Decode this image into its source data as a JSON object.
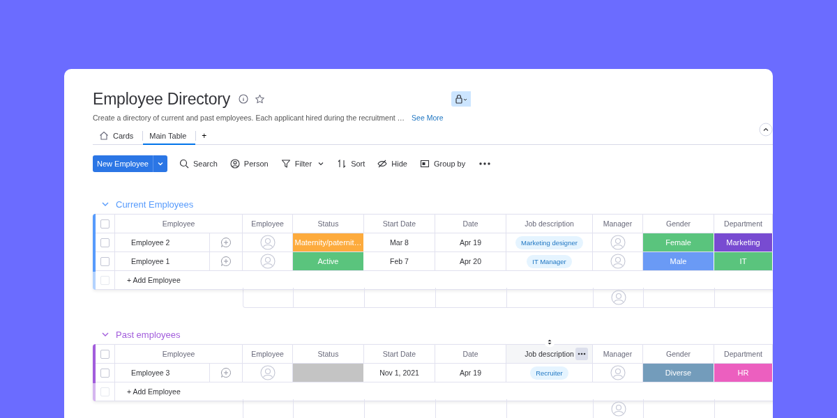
{
  "board": {
    "title": "Employee Directory",
    "description": "Create a directory of current and past employees. Each applicant hired during the recruitment …",
    "see_more": "See More"
  },
  "views": [
    {
      "label": "Cards",
      "kind": "home",
      "selected": false
    },
    {
      "label": "Main Table",
      "kind": "table",
      "selected": true
    }
  ],
  "add_view": "+",
  "toolbar": {
    "primary": "New Employee",
    "items": [
      {
        "label": "Search",
        "kind": "search"
      },
      {
        "label": "Person",
        "kind": "person"
      },
      {
        "label": "Filter",
        "kind": "filter"
      },
      {
        "label": "Sort",
        "kind": "sort"
      },
      {
        "label": "Hide",
        "kind": "hide"
      },
      {
        "label": "Group by",
        "kind": "group"
      }
    ]
  },
  "groups": [
    {
      "title": "Current Employees",
      "color": "#579bfc",
      "add_label": "+ Add Employee",
      "checked": false,
      "add_checkbox_disabled": true,
      "columns": [
        {
          "label": "Employee",
          "highlighted": false
        },
        {
          "label": "Employee",
          "highlighted": false
        },
        {
          "label": "Status",
          "highlighted": false
        },
        {
          "label": "Start Date",
          "highlighted": false
        },
        {
          "label": "Date",
          "highlighted": false
        },
        {
          "label": "Job description",
          "highlighted": false
        },
        {
          "label": "Manager",
          "highlighted": false
        },
        {
          "label": "Gender",
          "highlighted": false
        },
        {
          "label": "Department",
          "highlighted": false
        }
      ],
      "rows": [
        {
          "checked": false,
          "name": "Employee 2",
          "status": {
            "label": "Maternity/paternit…",
            "color": "#fdab3d"
          },
          "start_date": "Mar 8",
          "date": "Apr 19",
          "job": "Marketing designer",
          "gender": {
            "label": "Female",
            "color": "#5ac47d"
          },
          "department": {
            "label": "Marketing",
            "color": "#784bd1"
          }
        },
        {
          "checked": false,
          "name": "Employee 1",
          "status": {
            "label": "Active",
            "color": "#5ac47d"
          },
          "start_date": "Feb 7",
          "date": "Apr 20",
          "job": "IT Manager",
          "gender": {
            "label": "Male",
            "color": "#6a9af5"
          },
          "department": {
            "label": "IT",
            "color": "#5ac47d"
          }
        }
      ]
    },
    {
      "title": "Past employees",
      "color": "#a25ddc",
      "add_label": "+ Add Employee",
      "checked": false,
      "add_checkbox_disabled": true,
      "columns": [
        {
          "label": "Employee",
          "highlighted": false
        },
        {
          "label": "Employee",
          "highlighted": false
        },
        {
          "label": "Status",
          "highlighted": false
        },
        {
          "label": "Start Date",
          "highlighted": false
        },
        {
          "label": "Date",
          "highlighted": false
        },
        {
          "label": "Job description",
          "highlighted": true
        },
        {
          "label": "Manager",
          "highlighted": false
        },
        {
          "label": "Gender",
          "highlighted": false
        },
        {
          "label": "Department",
          "highlighted": false
        }
      ],
      "rows": [
        {
          "checked": false,
          "name": "Employee 3",
          "status": {
            "color": "#c4c4c4"
          },
          "start_date": "Nov 1, 2021",
          "date": "Apr 19",
          "job": "Recruiter",
          "gender": {
            "label": "Diverse",
            "color": "#739cbb"
          },
          "department": {
            "label": "HR",
            "color": "#ec5fbf"
          }
        }
      ]
    }
  ]
}
